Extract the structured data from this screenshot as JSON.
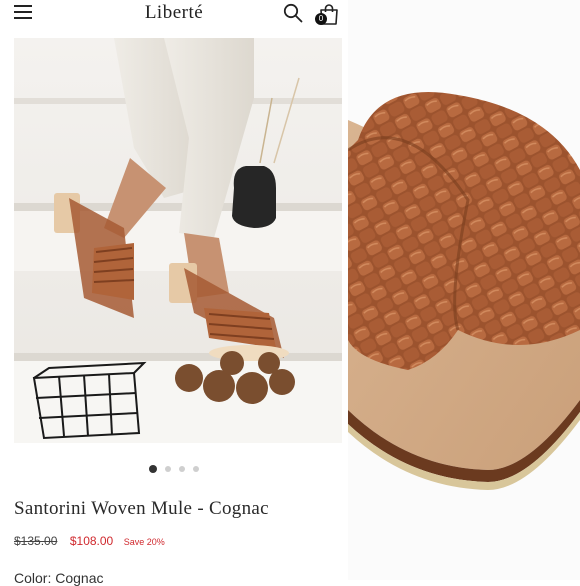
{
  "header": {
    "brand": "Liberté",
    "cart_count": "0",
    "icons": [
      "menu-icon",
      "search-icon",
      "shopping-bag-icon"
    ]
  },
  "gallery": {
    "slide_count": 4,
    "active_slide": 1
  },
  "product": {
    "title": "Santorini Woven Mule - Cognac",
    "original_price": "$135.00",
    "sale_price": "$108.00",
    "savings": "Save 20%",
    "color_line": "Color: Cognac"
  },
  "colors": {
    "sale_red": "#d0292e",
    "leather_cognac": "#a65a34",
    "text_dark": "#2a2a2a"
  }
}
